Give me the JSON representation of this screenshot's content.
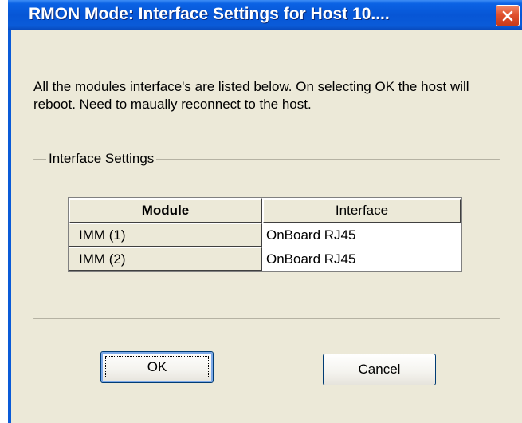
{
  "window": {
    "title": "RMON Mode: Interface Settings for Host 10...."
  },
  "icons": {
    "close": "close-icon"
  },
  "colors": {
    "titlebar": "#0a5bd8",
    "close_button": "#e0512e",
    "dialog_bg": "#ece9d8"
  },
  "message": "All the modules interface's are listed below. On selecting OK the host will reboot. Need to maually reconnect to the host.",
  "group": {
    "label": "Interface Settings"
  },
  "grid": {
    "headers": [
      "Module",
      "Interface"
    ],
    "rows": [
      {
        "module": "IMM (1)",
        "interface": "OnBoard RJ45"
      },
      {
        "module": "IMM (2)",
        "interface": "OnBoard RJ45"
      }
    ]
  },
  "buttons": {
    "ok": "OK",
    "cancel": "Cancel"
  }
}
